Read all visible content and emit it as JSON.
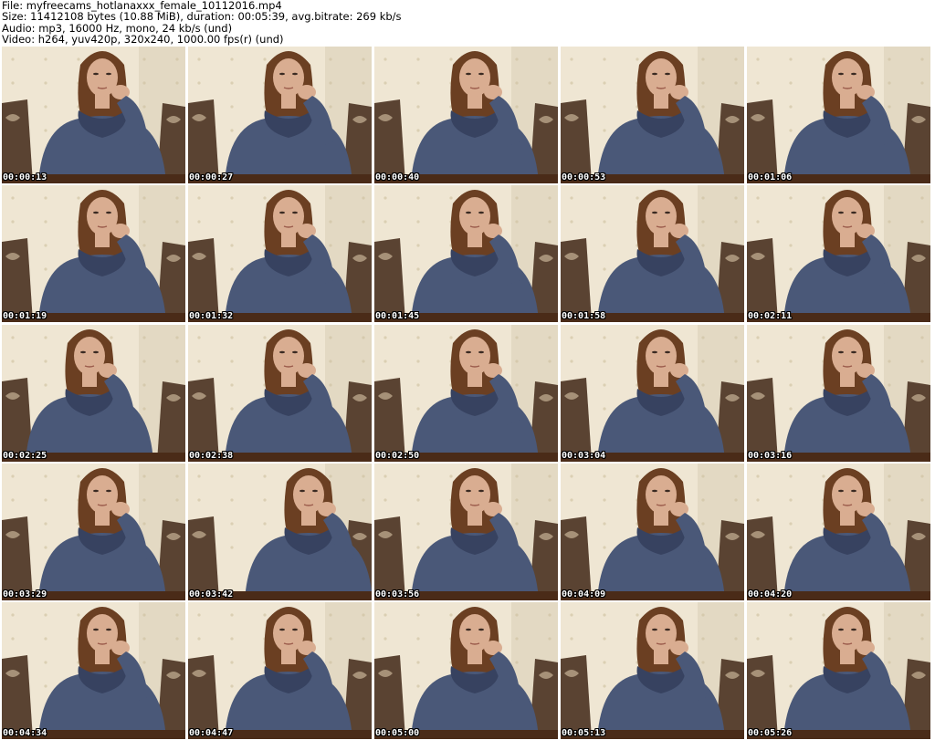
{
  "header": {
    "file_line": "File: myfreecams_hotlanaxxx_female_10112016.mp4",
    "size_line": "Size: 11412108 bytes (10.88 MiB), duration: 00:05:39, avg.bitrate: 269 kb/s",
    "audio_line": "Audio: mp3, 16000 Hz, mono, 24 kb/s (und)",
    "video_line": "Video: h264, yuv420p, 320x240, 1000.00 fps(r) (und)"
  },
  "thumbnails": [
    {
      "timestamp": "00:00:13"
    },
    {
      "timestamp": "00:00:27"
    },
    {
      "timestamp": "00:00:40"
    },
    {
      "timestamp": "00:00:53"
    },
    {
      "timestamp": "00:01:06"
    },
    {
      "timestamp": "00:01:19"
    },
    {
      "timestamp": "00:01:32"
    },
    {
      "timestamp": "00:01:45"
    },
    {
      "timestamp": "00:01:58"
    },
    {
      "timestamp": "00:02:11"
    },
    {
      "timestamp": "00:02:25"
    },
    {
      "timestamp": "00:02:38"
    },
    {
      "timestamp": "00:02:50"
    },
    {
      "timestamp": "00:03:04"
    },
    {
      "timestamp": "00:03:16"
    },
    {
      "timestamp": "00:03:29"
    },
    {
      "timestamp": "00:03:42"
    },
    {
      "timestamp": "00:03:56"
    },
    {
      "timestamp": "00:04:09"
    },
    {
      "timestamp": "00:04:20"
    },
    {
      "timestamp": "00:04:34"
    },
    {
      "timestamp": "00:04:47"
    },
    {
      "timestamp": "00:05:00"
    },
    {
      "timestamp": "00:05:13"
    },
    {
      "timestamp": "00:05:26"
    }
  ],
  "colors": {
    "wall": "#efe6d3",
    "wall_shadow": "#d8ccb4",
    "sofa": "#5a4332",
    "sweater": "#4a5878",
    "sweater_dark": "#374260",
    "hair": "#6b3f22",
    "skin": "#d9ad91",
    "table": "#4a2b18"
  }
}
